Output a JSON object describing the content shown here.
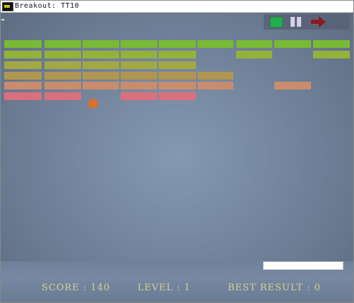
{
  "window": {
    "title": "Breakout: TT10"
  },
  "toolbar": {
    "play_icon": "play-square-icon",
    "pause_icon": "pause-icon",
    "exit_icon": "exit-arrow-icon",
    "colors": {
      "play": "#23b04c",
      "pause": "#d6d0ee",
      "exit": "#8b1a22"
    }
  },
  "hud": {
    "score": "SCORE : 140",
    "level": "LEVEL : 1",
    "best": "BEST RESULT : 0"
  },
  "colors": {
    "background": "#768aa2",
    "paddle": "#ffffff",
    "ball": "#d9702d",
    "hud_text": "#cfd38a",
    "brick_rows": [
      "#79b934",
      "#94b23a",
      "#a3a845",
      "#b19651",
      "#c98c6d",
      "#d9707e"
    ]
  },
  "bricks": {
    "present": [
      [
        true,
        true,
        true,
        true,
        true,
        true,
        true,
        true,
        true
      ],
      [
        true,
        true,
        true,
        true,
        true,
        false,
        true,
        false,
        true
      ],
      [
        true,
        true,
        true,
        true,
        true,
        false,
        false,
        false,
        false
      ],
      [
        true,
        true,
        true,
        true,
        true,
        true,
        false,
        false,
        false
      ],
      [
        true,
        true,
        true,
        true,
        true,
        true,
        false,
        true,
        false
      ],
      [
        true,
        true,
        false,
        true,
        true,
        false,
        false,
        false,
        false
      ]
    ]
  }
}
